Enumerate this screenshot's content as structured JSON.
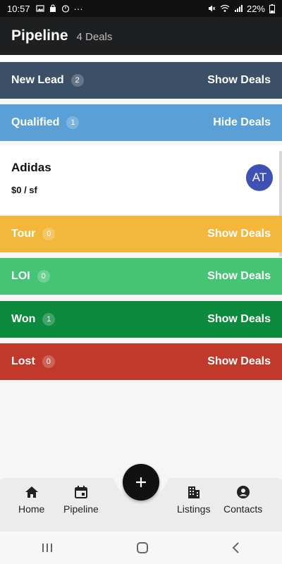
{
  "status_bar": {
    "time": "10:57",
    "battery": "22%",
    "icons": [
      "image-icon",
      "bag-icon",
      "timer-icon",
      "more-icon",
      "mute-icon",
      "wifi-icon",
      "signal-icon",
      "battery-icon"
    ]
  },
  "header": {
    "title": "Pipeline",
    "count": "4 Deals"
  },
  "stages": [
    {
      "name": "New Lead",
      "count": "2",
      "action": "Show Deals",
      "color": "#3b4f66"
    },
    {
      "name": "Qualified",
      "count": "1",
      "action": "Hide Deals",
      "color": "#5aa0d6"
    },
    {
      "name": "Tour",
      "count": "0",
      "action": "Show Deals",
      "color": "#f3b73c"
    },
    {
      "name": "LOI",
      "count": "0",
      "action": "Show Deals",
      "color": "#46c476"
    },
    {
      "name": "Won",
      "count": "1",
      "action": "Show Deals",
      "color": "#0c8a3e"
    },
    {
      "name": "Lost",
      "count": "0",
      "action": "Show Deals",
      "color": "#c0392b"
    }
  ],
  "deal": {
    "name": "Adidas",
    "price": "$0 / sf",
    "avatar_initials": "AT",
    "avatar_color": "#3f51b5"
  },
  "bottom_nav": {
    "home": "Home",
    "pipeline": "Pipeline",
    "listings": "Listings",
    "contacts": "Contacts",
    "fab_icon": "plus-icon"
  }
}
